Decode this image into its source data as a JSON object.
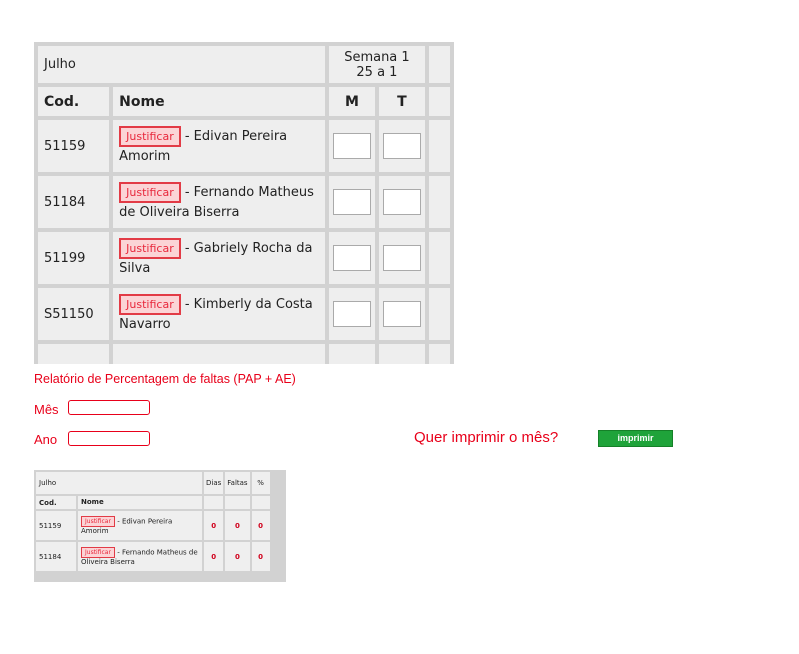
{
  "attendance": {
    "month": "Julho",
    "week_title": "Semana 1",
    "week_range": "25 a 1",
    "col_cod": "Cod.",
    "col_nome": "Nome",
    "col_m": "M",
    "col_t": "T",
    "justify_label": "Justificar",
    "students": [
      {
        "cod": "51159",
        "name": "- Edivan Pereira Amorim"
      },
      {
        "cod": "51184",
        "name": "- Fernando Matheus de Oliveira Biserra"
      },
      {
        "cod": "51199",
        "name": "- Gabriely Rocha da Silva"
      },
      {
        "cod": "S51150",
        "name": "- Kimberly da Costa Navarro"
      }
    ]
  },
  "report": {
    "title": "Relatório de Percentagem de faltas (PAP + AE)",
    "mes_label": "Mês",
    "ano_label": "Ano",
    "mes_value": "",
    "ano_value": "",
    "question": "Quer imprimir o mês?",
    "print_label": "imprimir"
  },
  "preview": {
    "month": "Julho",
    "col_dias": "Dias",
    "col_faltas": "Faltas",
    "col_pct": "%",
    "col_cod": "Cod.",
    "col_nome": "Nome",
    "justify_label": "Justificar",
    "students": [
      {
        "cod": "51159",
        "name": "- Edivan Pereira Amorim",
        "dias": "0",
        "faltas": "0",
        "pct": "0"
      },
      {
        "cod": "51184",
        "name": "- Fernando Matheus de Oliveira Biserra",
        "dias": "0",
        "faltas": "0",
        "pct": "0"
      }
    ]
  },
  "colors": {
    "accent_red": "#e8001a",
    "button_green": "#1fa33a",
    "table_bg": "#eeeeee"
  }
}
